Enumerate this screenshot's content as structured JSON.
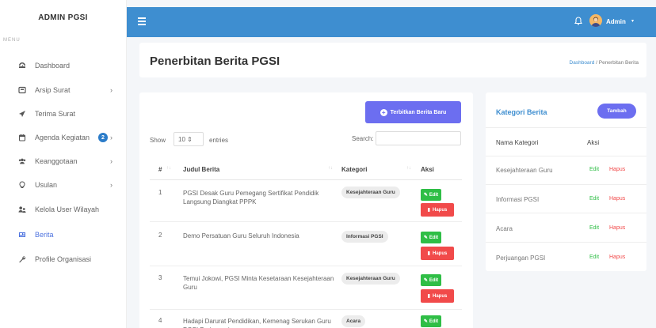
{
  "sidebar": {
    "brand": "ADMIN PGSI",
    "menu_label": "MENU",
    "items": [
      {
        "label": "Dashboard",
        "icon": "dashboard-icon"
      },
      {
        "label": "Arsip Surat",
        "icon": "archive-icon"
      },
      {
        "label": "Terima Surat",
        "icon": "send-icon"
      },
      {
        "label": "Agenda Kegiatan",
        "icon": "calendar-icon",
        "badge": "2"
      },
      {
        "label": "Keanggotaan",
        "icon": "users-icon"
      },
      {
        "label": "Usulan",
        "icon": "bulb-icon"
      },
      {
        "label": "Kelola User Wilayah",
        "icon": "user-group-icon"
      },
      {
        "label": "Berita",
        "icon": "newspaper-icon"
      },
      {
        "label": "Profile Organisasi",
        "icon": "wrench-icon"
      }
    ],
    "chevron": "›"
  },
  "topbar": {
    "menu_icon": "hamburger-icon",
    "user_name": "Admin",
    "caret": "▾"
  },
  "header": {
    "title": "Penerbitan Berita PGSI",
    "breadcrumb_home": "Dashboard",
    "breadcrumb_sep": " / ",
    "breadcrumb_current": "Penerbitan Berita"
  },
  "main": {
    "publish_button": "Terbitkan Berita Baru",
    "show_label": "Show",
    "show_value": "10 ⇕",
    "entries_label": "entries",
    "search_label": "Search:",
    "columns": {
      "no": "#",
      "title": "Judul Berita",
      "category": "Kategori",
      "action": "Aksi"
    },
    "sort_asc": "↑↓",
    "sort_both": "↑↓",
    "edit_label": "Edit",
    "delete_label": "Hapus",
    "rows": [
      {
        "no": "1",
        "title": "PGSI Desak Guru Pemegang Sertifikat Pendidik Langsung Diangkat PPPK",
        "category": "Kesejahteraan Guru"
      },
      {
        "no": "2",
        "title": "Demo Persatuan Guru Seluruh Indonesia",
        "category": "Informasi PGSI"
      },
      {
        "no": "3",
        "title": "Temui Jokowi, PGSI Minta Kesetaraan Kesejahteraan Guru",
        "category": "Kesejahteraan Guru"
      },
      {
        "no": "4",
        "title": "Hadapi Darurat Pendidikan, Kemenag Serukan Guru PGSI Berinovasi",
        "category": "Acara"
      }
    ]
  },
  "category_panel": {
    "title": "Kategori Berita",
    "add_button": "Tambah",
    "col_name": "Nama Kategori",
    "col_action": "Aksi",
    "edit_label": "Edit",
    "delete_label": "Hapus",
    "items": [
      "Kesejahteraan Guru",
      "Informasi PGSI",
      "Acara",
      "Perjuangan PGSI"
    ]
  },
  "colors": {
    "topbar": "#3e8ed0",
    "primary": "#6c6ef0",
    "success": "#2fbe46",
    "danger": "#f14a4a"
  }
}
